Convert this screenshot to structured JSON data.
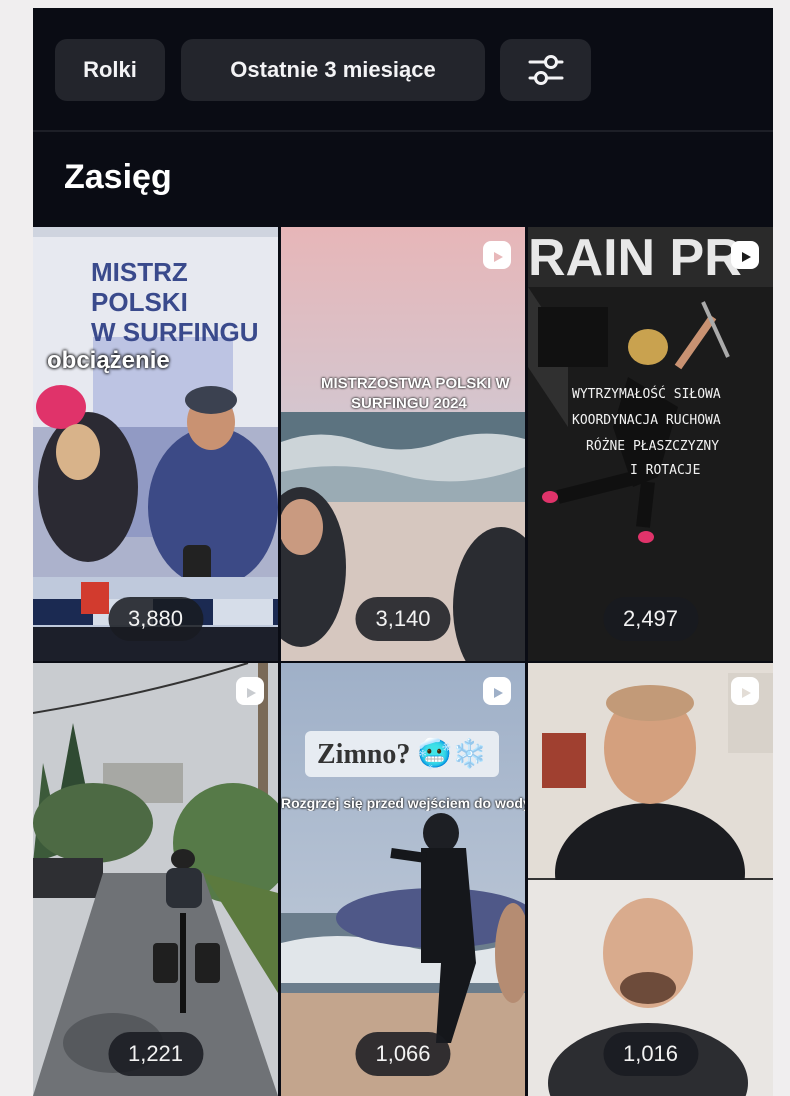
{
  "filters": {
    "type_chip": "Rolki",
    "range_chip": "Ostatnie 3 miesiące",
    "settings_icon": "sliders-icon"
  },
  "section": {
    "title": "Zasięg"
  },
  "tiles": [
    {
      "count": "3,880",
      "texts": [
        "MISTRZ",
        "POLSKI",
        "W SURFINGU",
        "obciążenie"
      ]
    },
    {
      "count": "3,140",
      "texts": [
        "MISTRZOSTWA POLSKI W",
        "SURFINGU 2024"
      ]
    },
    {
      "count": "2,497",
      "texts": [
        "WYTRZYMAŁOŚĆ SIŁOWA",
        "KOORDYNACJA RUCHOWA",
        "RÓŻNE PŁASZCZYZNY",
        "I ROTACJE"
      ]
    },
    {
      "count": "1,221",
      "texts": []
    },
    {
      "count": "1,066",
      "texts": [
        "Zimno? 🥶❄️",
        "Rozgrzej się przed wejściem do wody"
      ]
    },
    {
      "count": "1,016",
      "texts": []
    }
  ],
  "colors": {
    "app_bg": "#0a0c14",
    "chip_bg": "#23252c",
    "text": "#ffffff"
  }
}
